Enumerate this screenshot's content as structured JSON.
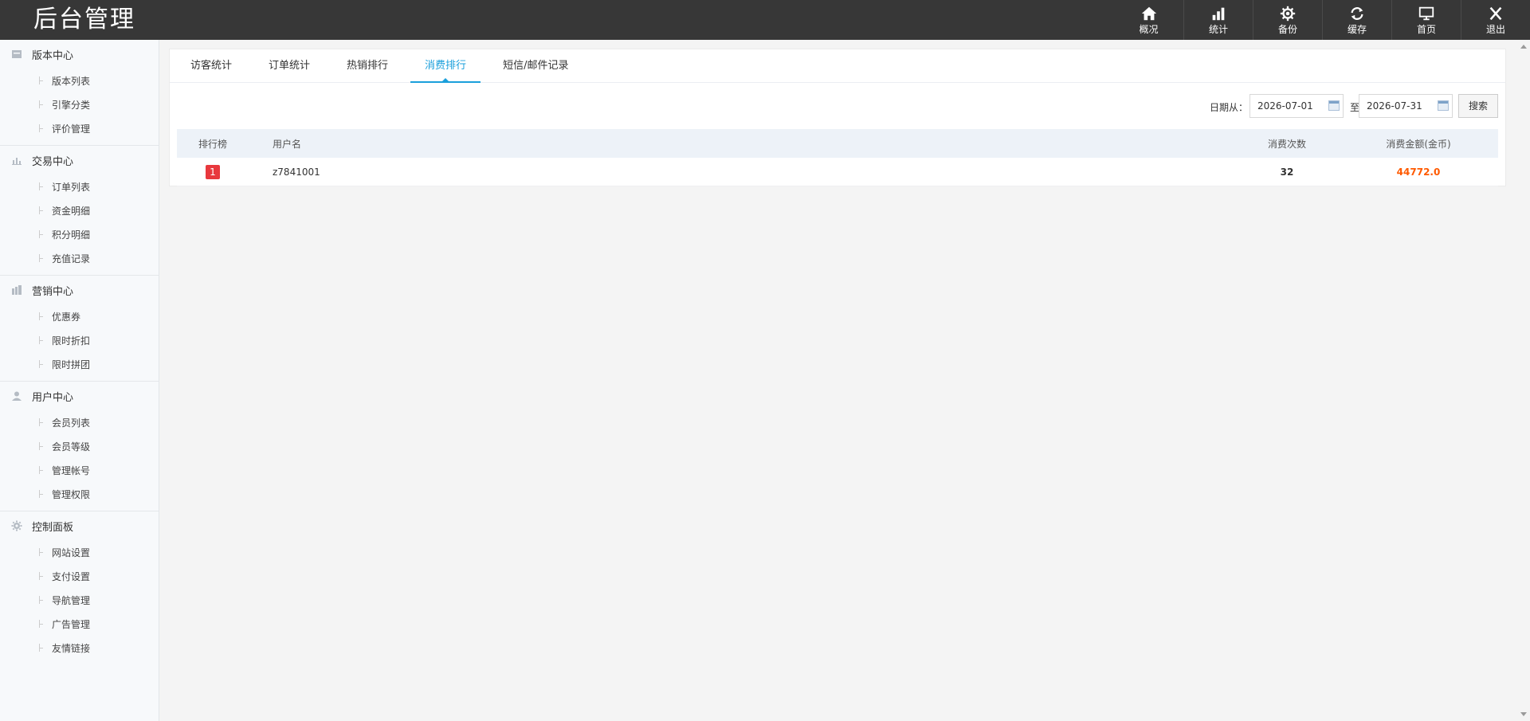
{
  "app": {
    "logo": "后台管理"
  },
  "topnav": [
    {
      "label": "概况",
      "icon": "home-icon"
    },
    {
      "label": "统计",
      "icon": "bar-chart-icon"
    },
    {
      "label": "备份",
      "icon": "gear-icon"
    },
    {
      "label": "缓存",
      "icon": "refresh-icon"
    },
    {
      "label": "首页",
      "icon": "monitor-icon"
    },
    {
      "label": "退出",
      "icon": "close-icon"
    }
  ],
  "sidebar": {
    "groups": [
      {
        "title": "版本中心",
        "icon": "folder-icon",
        "items": [
          "版本列表",
          "引擎分类",
          "评价管理"
        ]
      },
      {
        "title": "交易中心",
        "icon": "chart-icon",
        "items": [
          "订单列表",
          "资金明细",
          "积分明细",
          "充值记录"
        ]
      },
      {
        "title": "营销中心",
        "icon": "shop-icon",
        "items": [
          "优惠券",
          "限时折扣",
          "限时拼团"
        ]
      },
      {
        "title": "用户中心",
        "icon": "user-icon",
        "items": [
          "会员列表",
          "会员等级",
          "管理帐号",
          "管理权限"
        ]
      },
      {
        "title": "控制面板",
        "icon": "settings-icon",
        "items": [
          "网站设置",
          "支付设置",
          "导航管理",
          "广告管理",
          "友情链接"
        ]
      }
    ]
  },
  "tabs": [
    "访客统计",
    "订单统计",
    "热销排行",
    "消费排行",
    "短信/邮件记录"
  ],
  "active_tab": "消费排行",
  "filter": {
    "label": "日期从：",
    "from": "2026-07-01",
    "to_label": "至",
    "to": "2026-07-31",
    "search_label": "搜索"
  },
  "table": {
    "headers": {
      "rank": "排行榜",
      "user": "用户名",
      "count": "消费次数",
      "amount": "消费金额(金币)"
    },
    "rows": [
      {
        "rank": "1",
        "user": "z7841001",
        "count": "32",
        "amount": "44772.0"
      }
    ]
  },
  "colors": {
    "accent": "#1a9fdb",
    "header_bg": "#373737",
    "amount": "#ff5a00",
    "rank_badge": "#e8383d"
  }
}
